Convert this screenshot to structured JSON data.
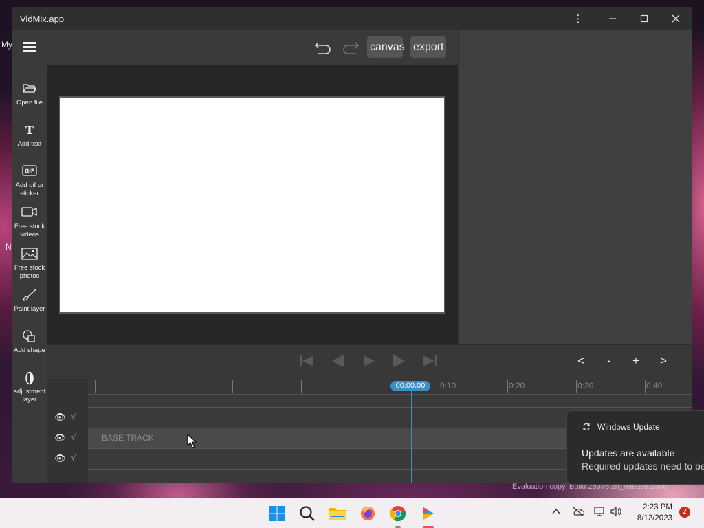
{
  "app": {
    "title": "VidMix.app",
    "toolbar": {
      "canvas_label": "canvas",
      "export_label": "export"
    },
    "sidebar": [
      {
        "label": "Open file",
        "icon": "folder-open-icon"
      },
      {
        "label": "Add text",
        "icon": "text-icon"
      },
      {
        "label": "Add gif or sticker",
        "icon": "gif-icon"
      },
      {
        "label": "Free stock videos",
        "icon": "video-camera-icon"
      },
      {
        "label": "Free stock photos",
        "icon": "image-icon"
      },
      {
        "label": "Paint layer",
        "icon": "brush-icon"
      },
      {
        "label": "Add shape",
        "icon": "shape-icon"
      },
      {
        "label": "adjustment layer",
        "icon": "adjustment-icon"
      }
    ],
    "zoom": {
      "prev": "<",
      "minus": "-",
      "plus": "+",
      "next": ">"
    },
    "timeline": {
      "playhead": "00:00.00",
      "ticks": [
        "0:10",
        "0:20",
        "0:30",
        "0:40"
      ],
      "base_track_label": "BASE TRACK"
    }
  },
  "desktop": {
    "fragments": [
      "My",
      "N"
    ],
    "evaluation_text": "Evaluation copy. Build 25375.zn_release.2305"
  },
  "toast": {
    "app_name": "Windows Update",
    "title": "Updates are available",
    "body": "Required updates need to be"
  },
  "taskbar": {
    "time": "2:23 PM",
    "date": "8/12/2023",
    "notification_count": "2"
  },
  "colors": {
    "accent": "#3b8ec7",
    "window_bg": "#3b3b3b",
    "canvas": "#ffffff"
  }
}
